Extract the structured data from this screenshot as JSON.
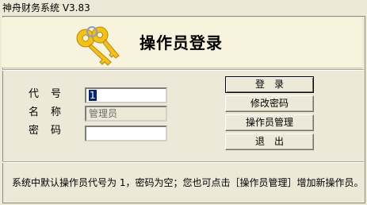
{
  "window": {
    "title": "神舟财务系统 V3.83"
  },
  "header": {
    "title": "操作员登录",
    "icon": "keys-icon"
  },
  "form": {
    "code_label": "代号",
    "code_value": "1",
    "name_label": "名称",
    "name_value": "管理员",
    "password_label": "密码",
    "password_value": ""
  },
  "buttons": {
    "login": "登　录",
    "change_password": "修改密码",
    "operator_manage": "操作员管理",
    "exit": "退　出"
  },
  "status": {
    "message": "系统中默认操作员代号为 1，密码为空；您也可点击［操作员管理］增加新操作员。"
  },
  "colors": {
    "window_bg": "#ece9d8",
    "header_bg": "#f8f3dc",
    "selection_bg": "#0a246a",
    "key_gold": "#f2c21b"
  }
}
